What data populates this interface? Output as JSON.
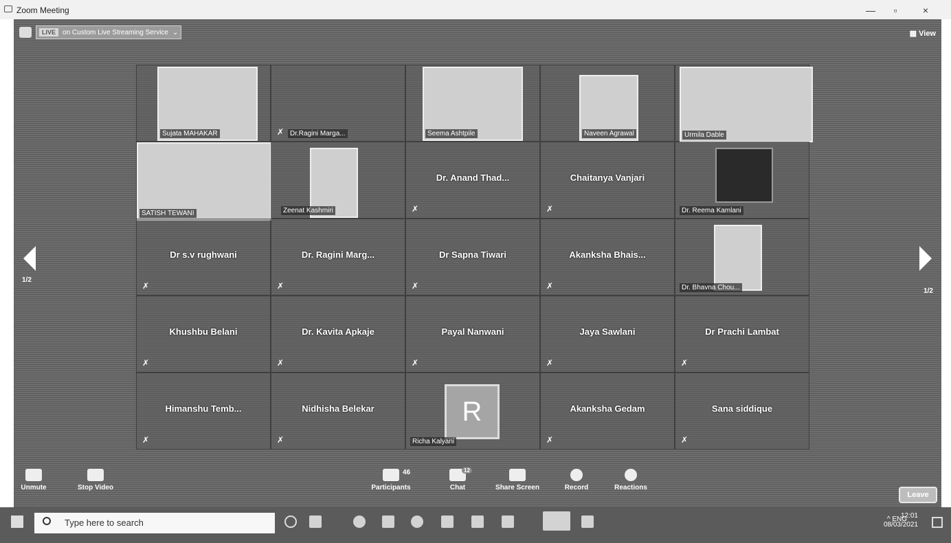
{
  "window": {
    "title": "Zoom Meeting"
  },
  "topbar": {
    "live_badge": "LIVE",
    "stream_text": "on Custom Live Streaming Service",
    "view_label": "View"
  },
  "pagination": {
    "left": "1/2",
    "right": "1/2"
  },
  "grid": {
    "row1": [
      {
        "name": "Sujata MAHAKAR",
        "video": true
      },
      {
        "name": "Dr.Ragini Marga...",
        "video": false
      },
      {
        "name": "Seema Ashtpile",
        "video": true
      },
      {
        "name": "Naveen Agrawal",
        "video": true
      },
      {
        "name": "Urmila Dable",
        "video": true
      }
    ],
    "row2": [
      {
        "name": "SATISH TEWANI",
        "video": true
      },
      {
        "name": "Zeenat Kashmiri",
        "video": true
      },
      {
        "name": "Dr. Anand Thad...",
        "video": false
      },
      {
        "name": "Chaitanya Vanjari",
        "video": false
      },
      {
        "name": "Dr. Reema Kamlani",
        "video": true
      }
    ],
    "row3": [
      {
        "name": "Dr s.v rughwani",
        "video": false
      },
      {
        "name": "Dr. Ragini Marg...",
        "video": false
      },
      {
        "name": "Dr Sapna Tiwari",
        "video": false
      },
      {
        "name": "Akanksha Bhais...",
        "video": false
      },
      {
        "name": "Dr. Bhavna Chou...",
        "video": true
      }
    ],
    "row4": [
      {
        "name": "Khushbu Belani",
        "video": false
      },
      {
        "name": "Dr. Kavita Apkaje",
        "video": false
      },
      {
        "name": "Payal Nanwani",
        "video": false
      },
      {
        "name": "Jaya Sawlani",
        "video": false
      },
      {
        "name": "Dr Prachi Lambat",
        "video": false
      }
    ],
    "row5": [
      {
        "name": "Himanshu Temb...",
        "video": false
      },
      {
        "name": "Nidhisha Belekar",
        "video": false
      },
      {
        "name": "Richa Kalyani",
        "avatar": "R"
      },
      {
        "name": "Akanksha Gedam",
        "video": false
      },
      {
        "name": "Sana siddique",
        "video": false
      }
    ]
  },
  "controls": {
    "unmute": "Unmute",
    "stop_video": "Stop Video",
    "participants": "Participants",
    "participants_count": "46",
    "chat": "Chat",
    "chat_count": "12",
    "share_screen": "Share Screen",
    "record": "Record",
    "reactions": "Reactions",
    "leave": "Leave"
  },
  "taskbar": {
    "search_placeholder": "Type here to search",
    "lang": "ENG",
    "time": "12:01",
    "date": "08/03/2021"
  }
}
